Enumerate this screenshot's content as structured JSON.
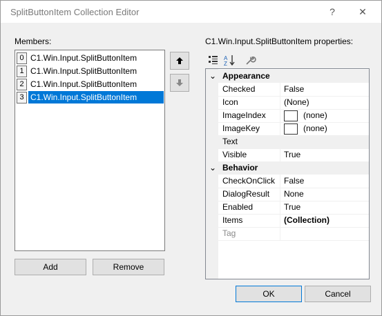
{
  "window": {
    "title": "SplitButtonItem Collection Editor",
    "help": "?",
    "close": "✕"
  },
  "members": {
    "label": "Members:",
    "items": [
      {
        "index": "0",
        "text": "C1.Win.Input.SplitButtonItem"
      },
      {
        "index": "1",
        "text": "C1.Win.Input.SplitButtonItem"
      },
      {
        "index": "2",
        "text": "C1.Win.Input.SplitButtonItem"
      },
      {
        "index": "3",
        "text": "C1.Win.Input.SplitButtonItem"
      }
    ],
    "selected_index": 3,
    "add_label": "Add",
    "remove_label": "Remove",
    "move_up": "🠕",
    "move_down": "🠗"
  },
  "properties": {
    "label": "C1.Win.Input.SplitButtonItem properties:",
    "categories": [
      {
        "name": "Appearance",
        "chevron": "⌄"
      },
      {
        "name": "Behavior",
        "chevron": "⌄"
      }
    ],
    "appearance": [
      {
        "name": "Checked",
        "value": "False"
      },
      {
        "name": "Icon",
        "value": "(None)"
      },
      {
        "name": "ImageIndex",
        "value": "(none)"
      },
      {
        "name": "ImageKey",
        "value": "(none)"
      },
      {
        "name": "Text",
        "value": ""
      },
      {
        "name": "Visible",
        "value": "True"
      }
    ],
    "behavior": [
      {
        "name": "CheckOnClick",
        "value": "False"
      },
      {
        "name": "DialogResult",
        "value": "None"
      },
      {
        "name": "Enabled",
        "value": "True"
      },
      {
        "name": "Items",
        "value": "(Collection)"
      },
      {
        "name": "Tag",
        "value": ""
      }
    ]
  },
  "footer": {
    "ok_label": "OK",
    "cancel_label": "Cancel"
  },
  "colors": {
    "selection": "#0078d7",
    "default_button_border": "#0078d7"
  }
}
